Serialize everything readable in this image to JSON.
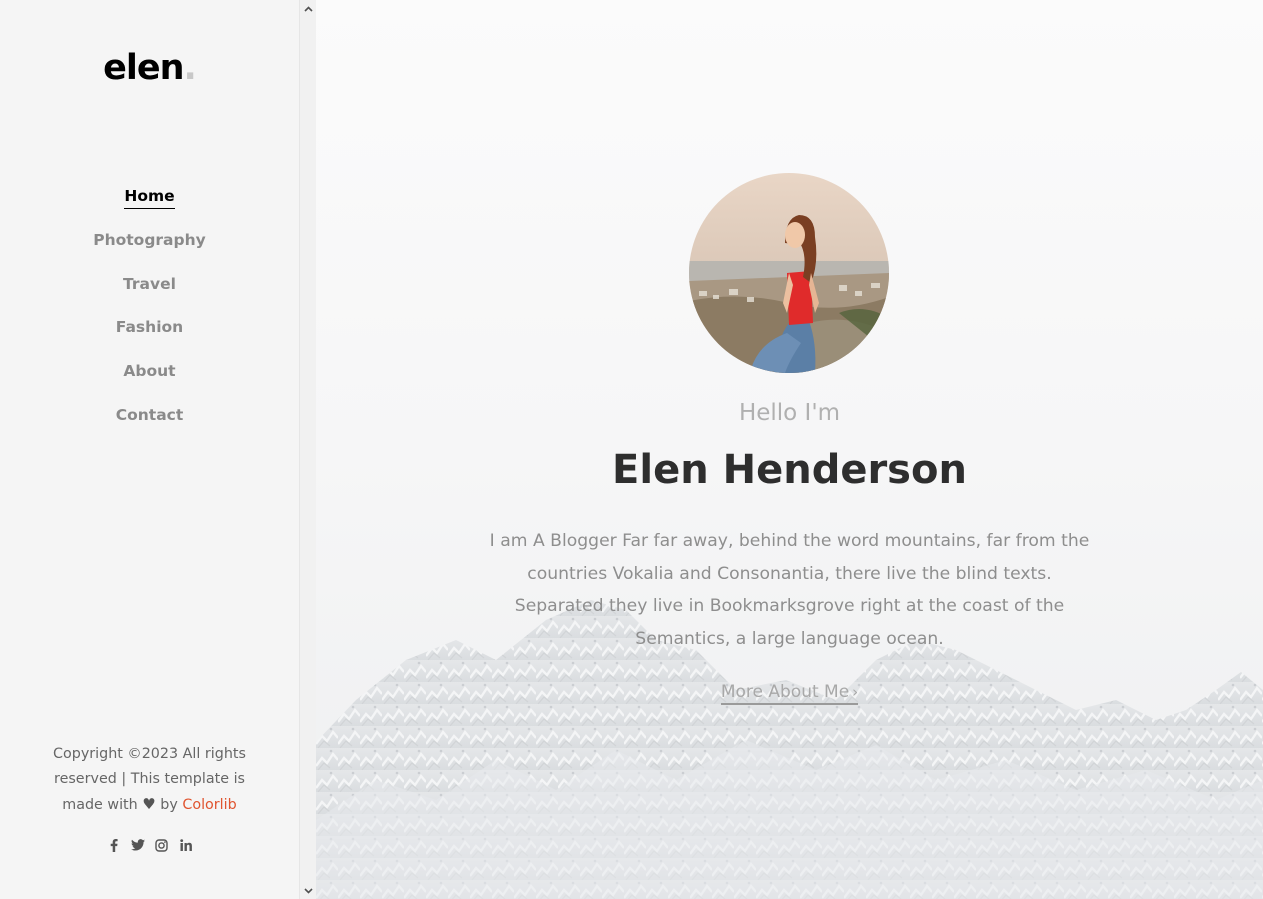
{
  "sidebar": {
    "logo": {
      "text": "elen",
      "dot": "."
    },
    "nav": [
      {
        "label": "Home",
        "active": true
      },
      {
        "label": "Photography",
        "active": false
      },
      {
        "label": "Travel",
        "active": false
      },
      {
        "label": "Fashion",
        "active": false
      },
      {
        "label": "About",
        "active": false
      },
      {
        "label": "Contact",
        "active": false
      }
    ],
    "footer": {
      "copyright_line1": "Copyright ©2023 All rights",
      "copyright_line2": "reserved | This template is",
      "made_with": "made with",
      "heart_icon": "heart-icon",
      "by": "by",
      "brand": "Colorlib"
    },
    "social_icons": [
      "facebook-icon",
      "twitter-icon",
      "instagram-icon",
      "linkedin-icon"
    ]
  },
  "hero": {
    "greeting": "Hello I'm",
    "name": "Elen Henderson",
    "bio": "I am A Blogger Far far away, behind the word mountains, far from the countries Vokalia and Consonantia, there live the blind texts. Separated they live in Bookmarksgrove right at the coast of the Semantics, a large language ocean.",
    "cta": "More About Me",
    "cta_icon": "chevron-right-icon"
  },
  "colors": {
    "accent": "#e0542f",
    "sidebar_bg": "#f5f5f5",
    "name_text": "#2e2e2e",
    "nav_inactive": "#8a8a8a"
  }
}
